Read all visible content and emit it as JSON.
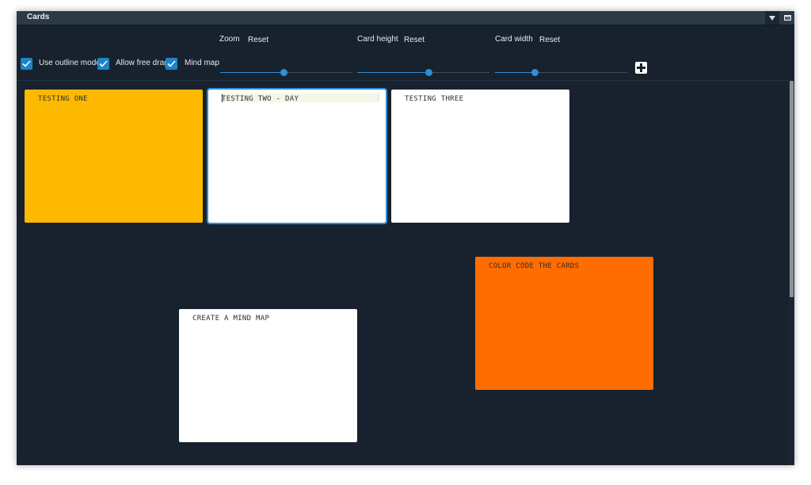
{
  "window": {
    "title": "Cards"
  },
  "toolbar": {
    "outline_mode": {
      "label": "Use outline mode",
      "checked": true
    },
    "free_drag": {
      "label": "Allow free drag",
      "checked": true
    },
    "mind_map": {
      "label": "Mind map",
      "checked": true
    },
    "zoom": {
      "label": "Zoom",
      "reset_label": "Reset",
      "value_fraction": 0.48
    },
    "card_height": {
      "label": "Card height",
      "reset_label": "Reset",
      "value_fraction": 0.54
    },
    "card_width": {
      "label": "Card width",
      "reset_label": "Reset",
      "value_fraction": 0.3
    },
    "add_icon": "plus-icon"
  },
  "cards": [
    {
      "text": "TESTING ONE",
      "color": "#fdb900"
    },
    {
      "text": "TESTING TWO - DAY",
      "color": "#ffffff",
      "selected": true,
      "menu_glyph": "⋮"
    },
    {
      "text": "TESTING THREE",
      "color": "#ffffff"
    },
    {
      "text": "COLOR CODE THE CARDS",
      "color": "#ff6c00"
    },
    {
      "text": "CREATE A MIND MAP",
      "color": "#ffffff"
    }
  ],
  "colors": {
    "background": "#17222e",
    "accent": "#1d84c6",
    "titlebar": "#2c3a48"
  }
}
